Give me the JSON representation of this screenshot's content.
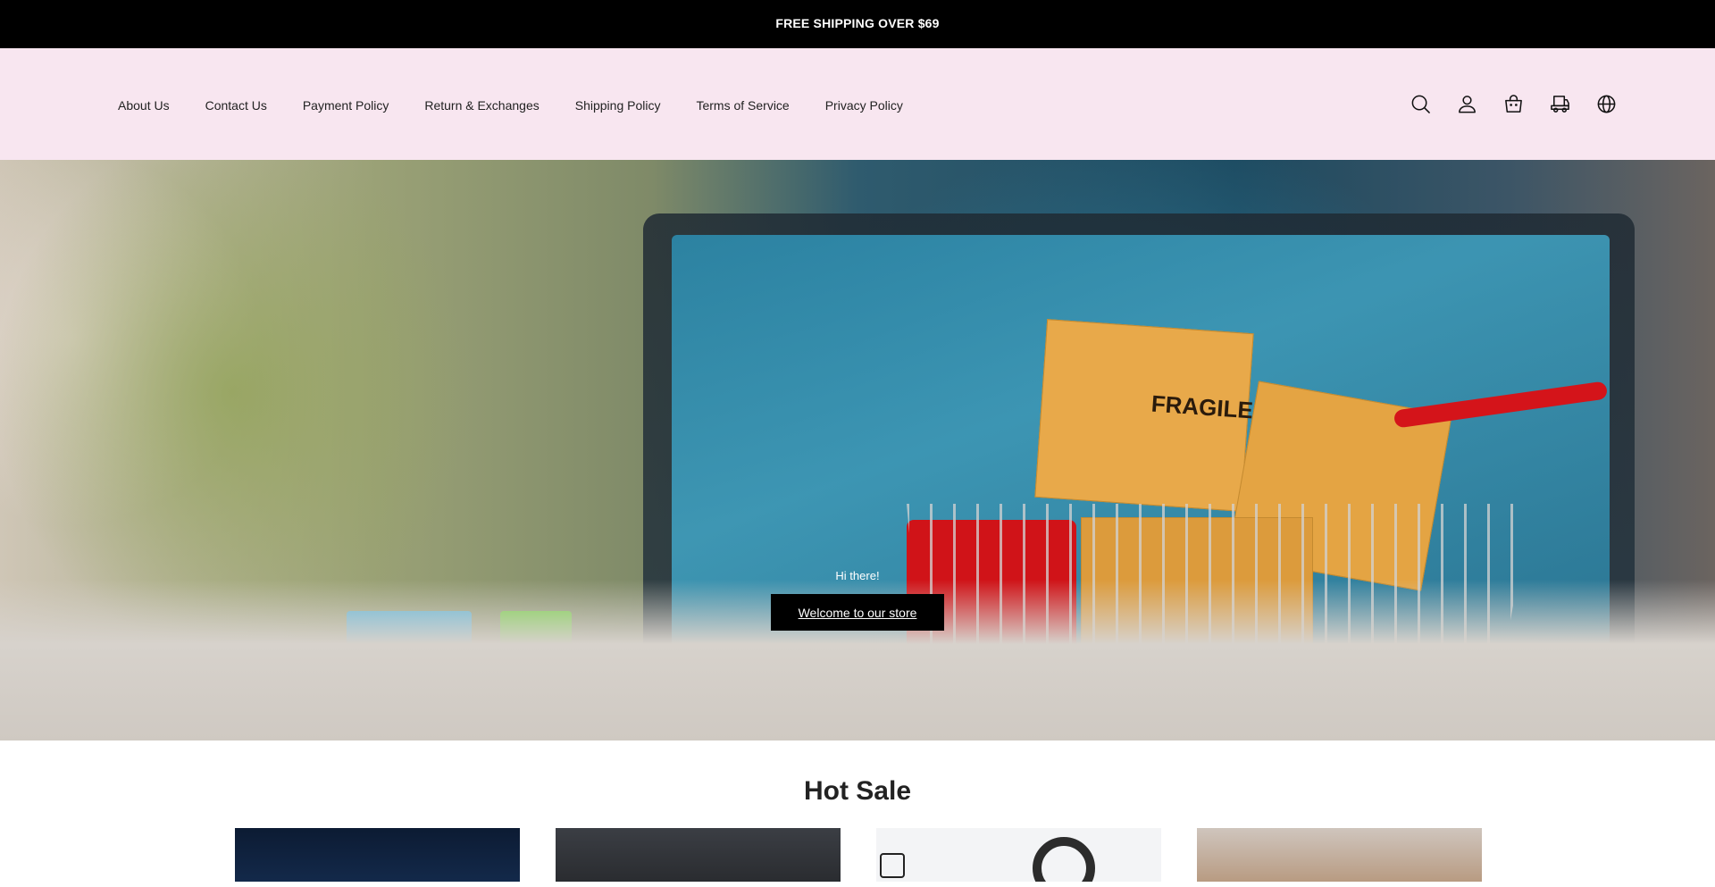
{
  "announcement": {
    "text": "FREE SHIPPING OVER $69"
  },
  "nav": {
    "items": [
      {
        "label": "About Us"
      },
      {
        "label": "Contact Us"
      },
      {
        "label": "Payment Policy"
      },
      {
        "label": "Return & Exchanges"
      },
      {
        "label": "Shipping Policy"
      },
      {
        "label": "Terms of Service"
      },
      {
        "label": "Privacy Policy"
      }
    ]
  },
  "header_icons": [
    "search-icon",
    "account-icon",
    "cart-icon",
    "order-tracking-icon",
    "language-icon"
  ],
  "hero": {
    "subtitle": "Hi there!",
    "button_label": "Welcome to our store",
    "image_text": "FRAGILE"
  },
  "hot_sale": {
    "title": "Hot Sale"
  },
  "colors": {
    "announcement_bg": "#000000",
    "header_bg": "#f8e6f0",
    "button_bg": "#000000"
  }
}
